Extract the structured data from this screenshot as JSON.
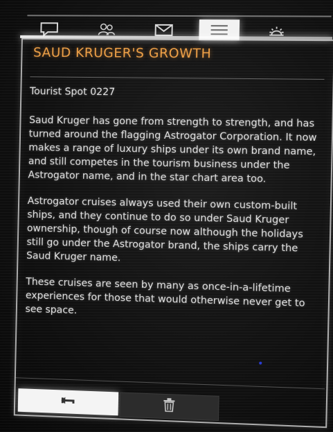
{
  "tabs": [
    {
      "icon": "chat-bubble-icon",
      "active": false
    },
    {
      "icon": "contacts-icon",
      "active": false
    },
    {
      "icon": "mail-icon",
      "active": false
    },
    {
      "icon": "list-icon",
      "active": true
    },
    {
      "icon": "settings-icon",
      "active": false
    }
  ],
  "message": {
    "title": "SAUD KRUGER'S GROWTH",
    "subtitle": "Tourist Spot 0227",
    "paragraphs": [
      "Saud Kruger has gone from strength to strength, and has turned around the flagging Astrogator Corporation. It now makes a range of luxury ships under its own brand name, and still competes in the tourism business under the Astrogator name, and in the star chart area too.",
      "Astrogator cruises always used their own custom-built ships, and they continue to do so under Saud Kruger ownership, though of course now although the holidays still go under the Astrogator brand, the ships carry the Saud Kruger name.",
      "These cruises are seen by many as once-in-a-lifetime experiences for those that would otherwise never get to see space."
    ]
  },
  "actions": {
    "back_icon": "back-arrow-icon",
    "delete_icon": "trash-icon"
  },
  "colors": {
    "title": "#f0a248",
    "text": "#e4e4e4",
    "active_tab": "#f2f2f2",
    "background": "#0b0b0b"
  }
}
